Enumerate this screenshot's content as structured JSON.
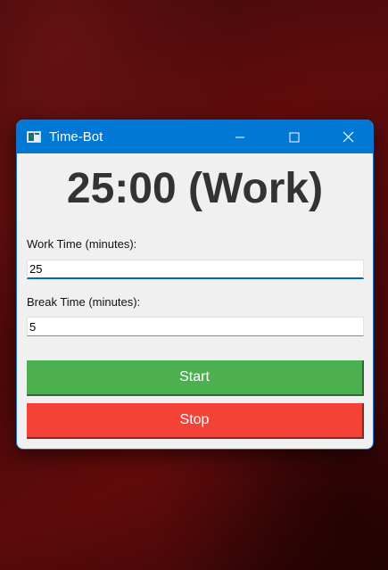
{
  "window": {
    "title": "Time-Bot",
    "icons": {
      "app": "app-icon",
      "minimize": "minimize-icon",
      "maximize": "maximize-icon",
      "close": "close-icon"
    }
  },
  "timer": {
    "display": "25:00 (Work)"
  },
  "work": {
    "label": "Work Time (minutes):",
    "value": "25"
  },
  "break": {
    "label": "Break Time (minutes):",
    "value": "5"
  },
  "buttons": {
    "start_label": "Start",
    "stop_label": "Stop"
  },
  "colors": {
    "titlebar": "#0078d4",
    "start": "#4caf50",
    "stop": "#f44336",
    "focus_underline": "#0067c0"
  }
}
